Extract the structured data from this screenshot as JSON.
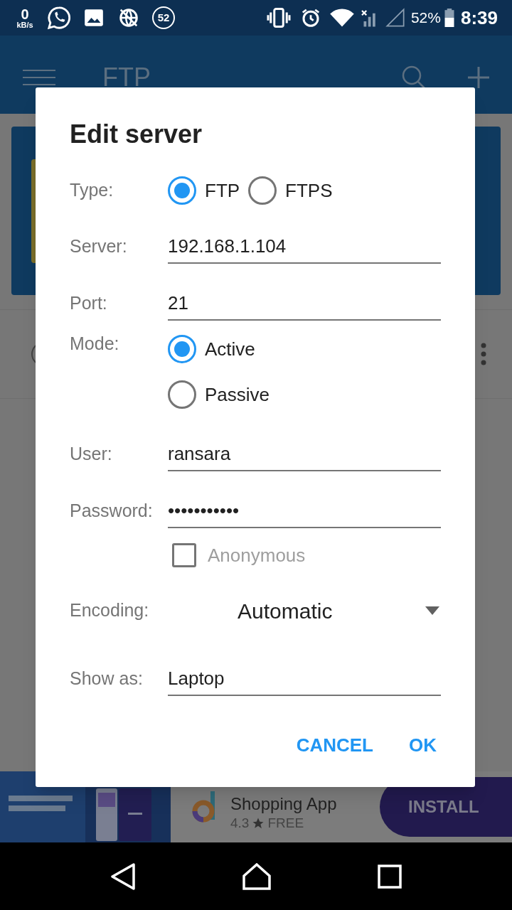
{
  "status_bar": {
    "speed": "0",
    "speed_unit": "kB/s",
    "notification_count": "52",
    "battery": "52%",
    "time": "8:39"
  },
  "app_bar": {
    "title": "FTP"
  },
  "dialog": {
    "title": "Edit server",
    "fields": [
      {
        "kind": "radio_inline",
        "label": "Type:",
        "options": [
          {
            "label": "FTP",
            "selected": true
          },
          {
            "label": "FTPS",
            "selected": false
          }
        ]
      },
      {
        "kind": "text",
        "label": "Server:",
        "value": "192.168.1.104"
      },
      {
        "kind": "text",
        "label": "Port:",
        "value": "21"
      },
      {
        "kind": "radio_stack",
        "label": "Mode:",
        "options": [
          {
            "label": "Active",
            "selected": true
          },
          {
            "label": "Passive",
            "selected": false
          }
        ]
      },
      {
        "kind": "text",
        "label": "User:",
        "value": "ransara"
      },
      {
        "kind": "text",
        "label": "Password:",
        "value": "•••••••••••"
      },
      {
        "kind": "checkbox",
        "label": "Anonymous",
        "checked": false
      },
      {
        "kind": "dropdown",
        "label": "Encoding:",
        "value": "Automatic"
      },
      {
        "kind": "text",
        "label": "Show as:",
        "value": "Laptop"
      }
    ],
    "buttons": [
      "CANCEL",
      "OK"
    ]
  },
  "ad": {
    "title_line2": "Shopping App",
    "rating": "4.3",
    "price": "FREE",
    "button": "INSTALL"
  }
}
